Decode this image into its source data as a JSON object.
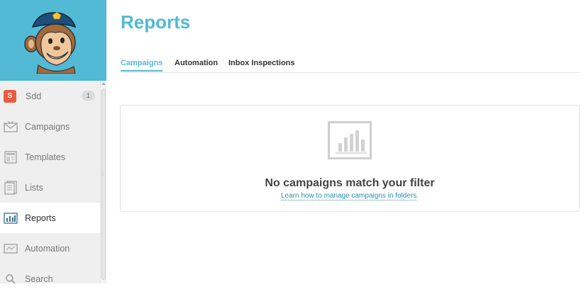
{
  "sidebar": {
    "user": {
      "initial": "S",
      "name": "Sdd",
      "count": "1"
    },
    "items": [
      {
        "label": "Campaigns",
        "icon": "envelope-icon"
      },
      {
        "label": "Templates",
        "icon": "template-icon"
      },
      {
        "label": "Lists",
        "icon": "lists-icon"
      },
      {
        "label": "Reports",
        "icon": "bar-chart-icon",
        "active": true
      },
      {
        "label": "Automation",
        "icon": "automation-icon"
      },
      {
        "label": "Search",
        "icon": "search-icon"
      }
    ]
  },
  "page": {
    "title": "Reports"
  },
  "tabs": [
    {
      "label": "Campaigns",
      "active": true
    },
    {
      "label": "Automation"
    },
    {
      "label": "Inbox Inspections"
    }
  ],
  "empty_state": {
    "icon": "bar-chart-icon",
    "title": "No campaigns match your filter",
    "link_text": "Learn how to manage campaigns in folders",
    "link_suffix": "."
  },
  "colors": {
    "brand_blue": "#52bad5",
    "sidebar_bg": "#efefef",
    "user_badge": "#e85c41"
  }
}
